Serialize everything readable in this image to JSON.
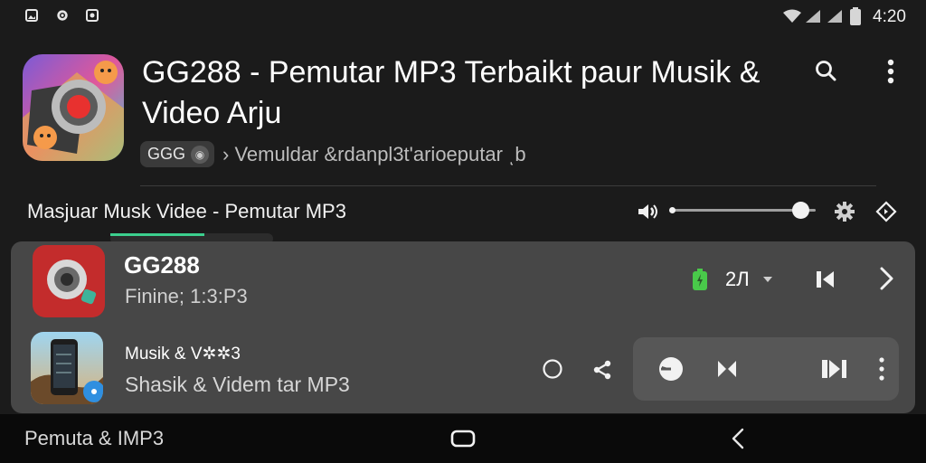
{
  "status_bar": {
    "time": "4:20",
    "left_icons": [
      "gallery-icon",
      "settings-gear-icon",
      "camera-icon"
    ],
    "right_icons": [
      "wifi-icon",
      "signal-icon",
      "signal-icon",
      "battery-icon"
    ]
  },
  "app": {
    "title": "GG288 - Pemutar MP3 Terbaikt paur Musik & Video Arju",
    "developer_chip": "GGG",
    "subtitle": "› Vemuldar &rdanpl3t'arioeputar ͺb"
  },
  "section": {
    "title": "Masjuar Musk Videe - Pemutar MP3"
  },
  "playlist": [
    {
      "title": "GG288",
      "subtitle": "Finine; 1:3:P3",
      "count": "2Л"
    },
    {
      "title": "Musik & V✲✲3",
      "subtitle": "Shasik & Videm   tar MP3"
    }
  ],
  "nav": {
    "label": "Pemuta & ΙΜP3"
  },
  "colors": {
    "background": "#1b1b1b",
    "panel": "#474747",
    "accent_green": "#3ccf8e",
    "battery_green": "#49c94a"
  }
}
